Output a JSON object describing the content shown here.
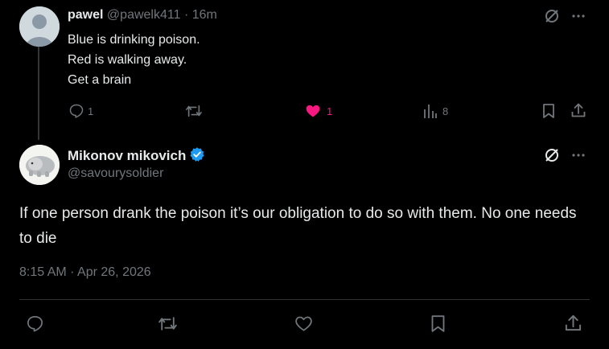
{
  "reply": {
    "name": "pawel",
    "handle": "@pawelk411",
    "sep": "·",
    "time": "16m",
    "lines": [
      "Blue is drinking poison.",
      "Red is walking away.",
      "Get a brain"
    ],
    "replies": "1",
    "likes": "1",
    "views": "8",
    "like_color": "#f91880"
  },
  "post": {
    "name": "Mikonov mikovich",
    "handle": "@savourysoldier",
    "text": "If one person drank the poison it’s our obligation to do so with them. No one needs to die",
    "timestamp": "8:15 AM · Apr 26, 2026",
    "verified_color": "#1d9bf0"
  },
  "icons": [
    "grok-icon",
    "more-icon",
    "reply-icon",
    "repost-icon",
    "like-icon",
    "views-icon",
    "bookmark-icon",
    "share-icon",
    "verified-badge-icon"
  ]
}
